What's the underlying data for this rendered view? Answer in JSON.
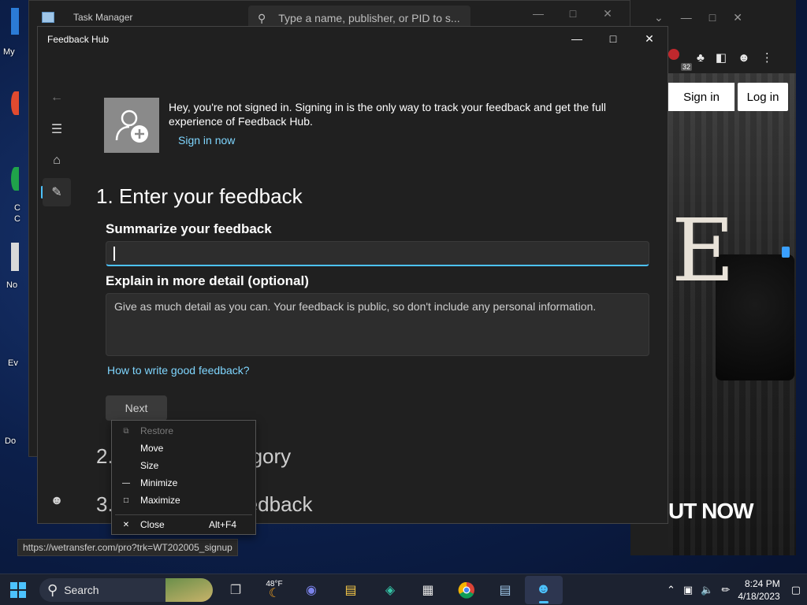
{
  "desktop": {
    "labels": [
      "My",
      "C",
      "C",
      "No",
      "Ev",
      "Do"
    ]
  },
  "task_manager": {
    "title": "Task Manager",
    "search_placeholder": "Type a name, publisher, or PID to s..."
  },
  "browser": {
    "extensions_badge": "32",
    "sign_in_label": "Sign in",
    "log_in_label": "Log in",
    "big_letter": "E",
    "banner_text": "UT NOW",
    "status_url": "https://wetransfer.com/pro?trk=WT202005_signup"
  },
  "feedback_hub": {
    "title": "Feedback Hub",
    "signin_message": "Hey, you're not signed in. Signing in is the only way to track your feedback and get the full experience of Feedback Hub.",
    "signin_link": "Sign in now",
    "step1_heading": "1. Enter your feedback",
    "summary_label": "Summarize your feedback",
    "summary_value": "",
    "detail_label": "Explain in more detail (optional)",
    "detail_placeholder": "Give as much detail as you can. Your feedback is public, so don't include any personal information.",
    "help_link": "How to write good feedback?",
    "next_label": "Next",
    "step2_heading": "2. Choose a category",
    "step3_heading": "3. Find similar feedback"
  },
  "context_menu": {
    "restore": "Restore",
    "move": "Move",
    "size": "Size",
    "minimize": "Minimize",
    "maximize": "Maximize",
    "close": "Close",
    "close_shortcut": "Alt+F4"
  },
  "taskbar": {
    "search_label": "Search",
    "weather": "48°F",
    "time": "8:24 PM",
    "date": "4/18/2023"
  },
  "colors": {
    "accent": "#4cc2ff",
    "link": "#7fd6ff",
    "window_bg": "#202020"
  }
}
